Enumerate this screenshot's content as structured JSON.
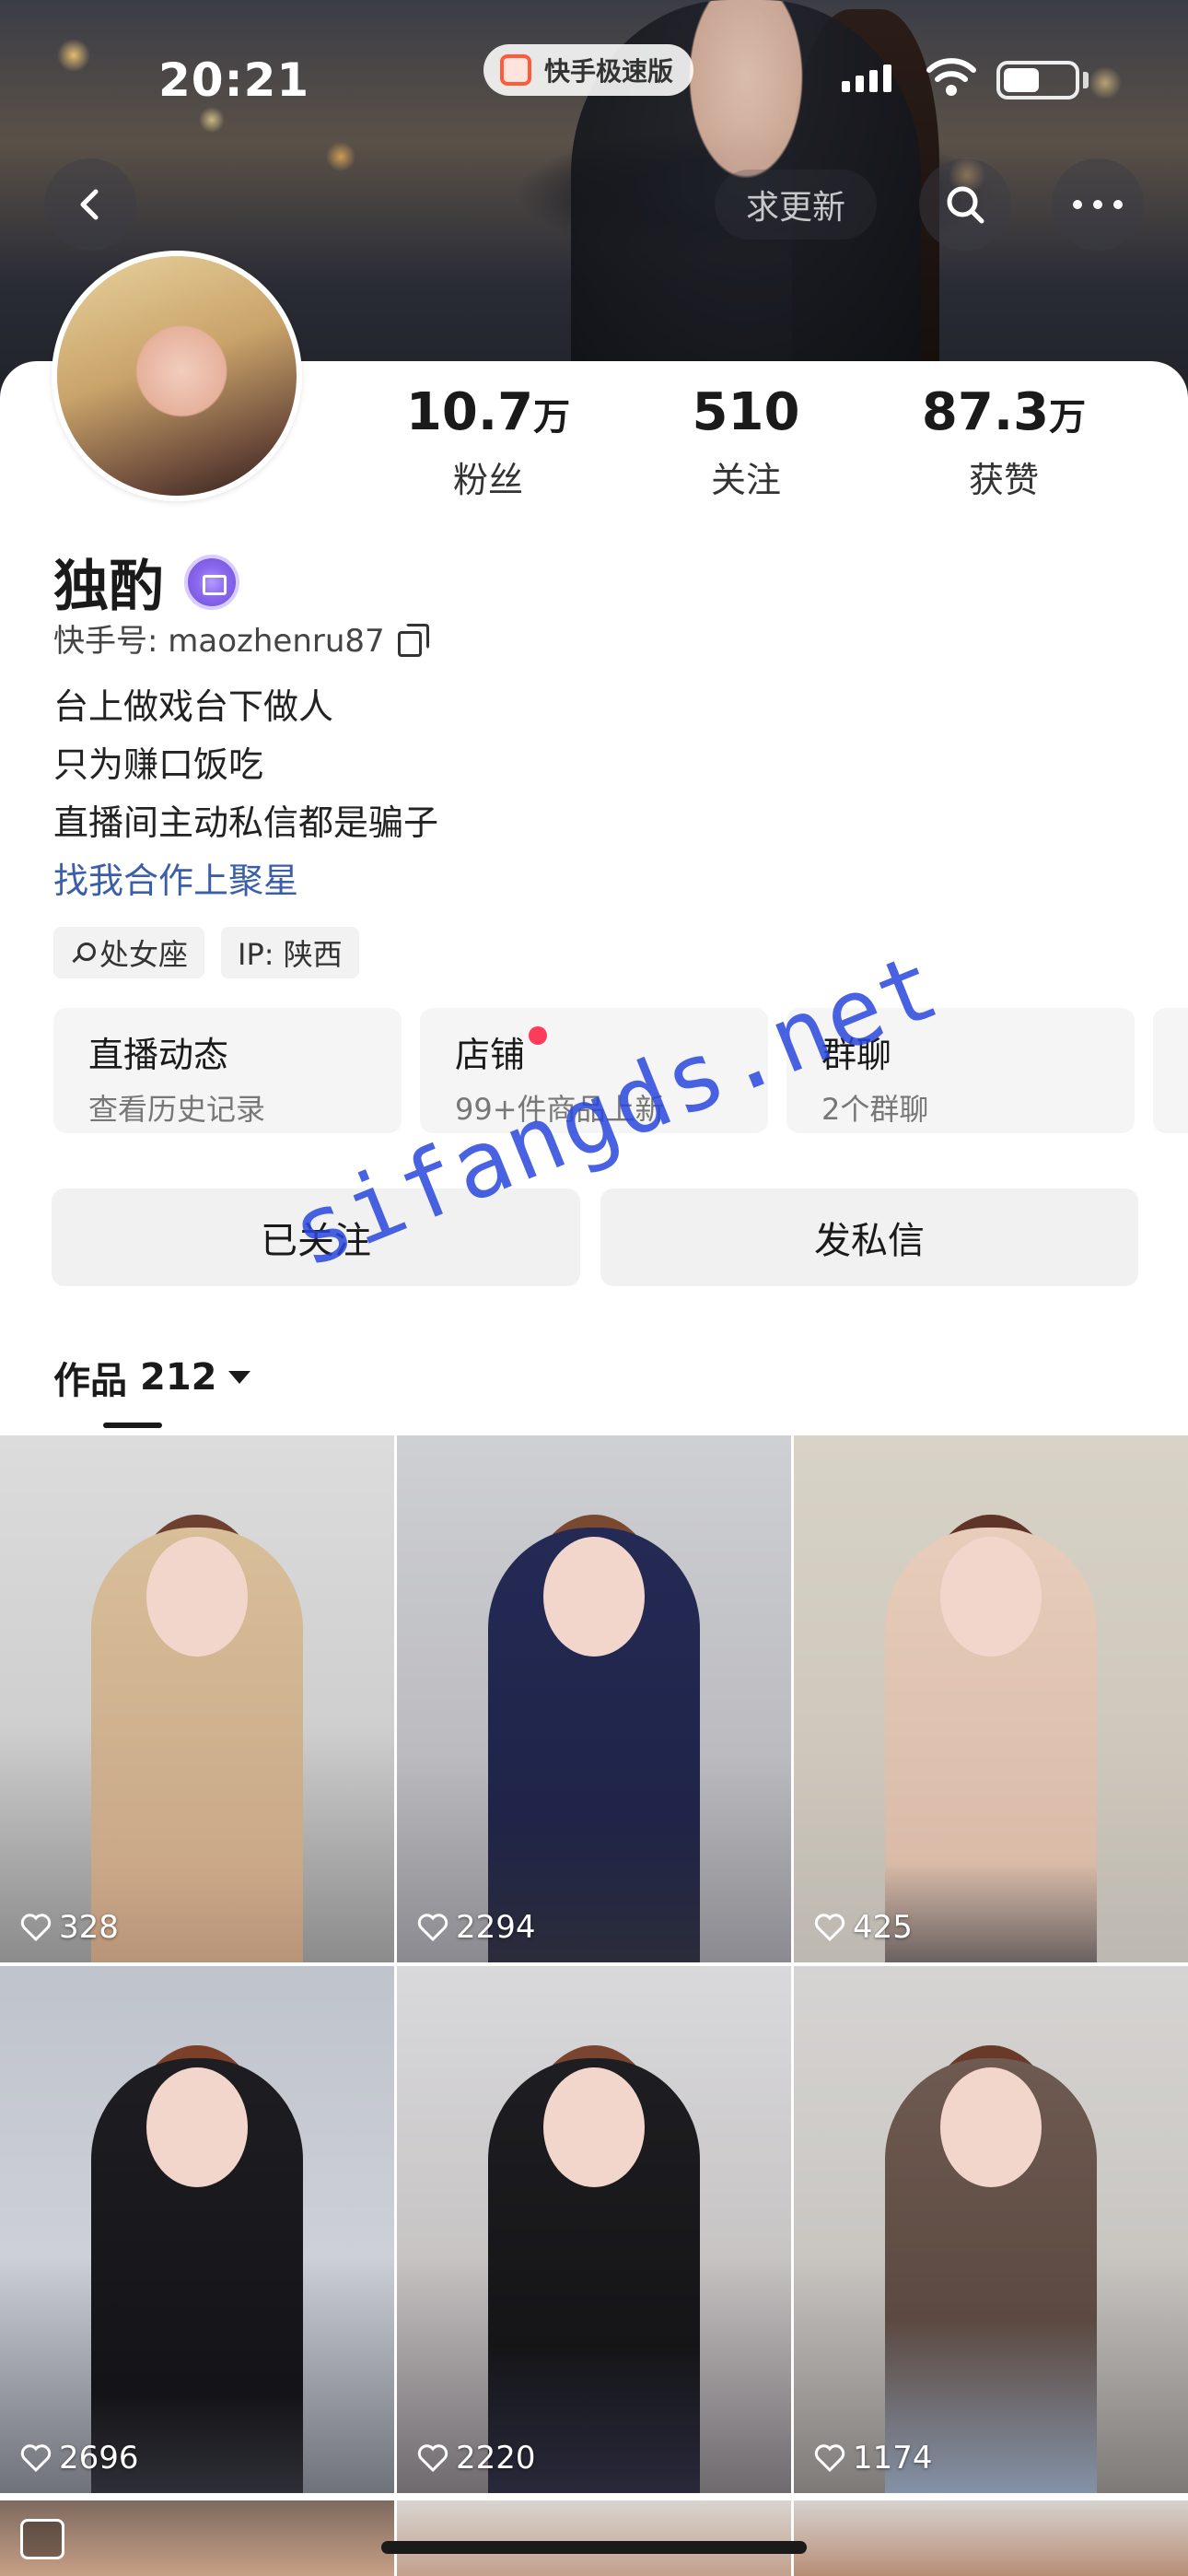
{
  "status_bar": {
    "time": "20:21",
    "app_pill": "快手极速版"
  },
  "header": {
    "update_label": "求更新"
  },
  "profile": {
    "name": "独酌",
    "uid_label": "快手号: maozhenru87",
    "stats": [
      {
        "value": "10.7",
        "unit": "万",
        "label": "粉丝"
      },
      {
        "value": "510",
        "unit": "",
        "label": "关注"
      },
      {
        "value": "87.3",
        "unit": "万",
        "label": "获赞"
      }
    ],
    "bio_lines": [
      "台上做戏台下做人",
      "只为赚口饭吃",
      "直播间主动私信都是骗子"
    ],
    "bio_link": "找我合作上聚星",
    "tags": [
      "处女座",
      "IP: 陕西"
    ]
  },
  "shortcuts": [
    {
      "title": "直播动态",
      "subtitle": "查看历史记录"
    },
    {
      "title": "店铺",
      "subtitle": "99+件商品上新"
    },
    {
      "title": "群聊",
      "subtitle": "2个群聊"
    }
  ],
  "actions": {
    "followed_label": "已关注",
    "message_label": "发私信"
  },
  "works": {
    "label": "作品",
    "count": "212"
  },
  "videos": [
    {
      "likes": "328"
    },
    {
      "likes": "2294"
    },
    {
      "likes": "425"
    },
    {
      "likes": "2696"
    },
    {
      "likes": "2220"
    },
    {
      "likes": "1174"
    }
  ],
  "watermark": "sifangds.net",
  "colors": {
    "link": "#3a5fa8",
    "badge": "#8e6cf0",
    "notify_dot": "#ff3b5c",
    "watermark": "#2846dc"
  }
}
